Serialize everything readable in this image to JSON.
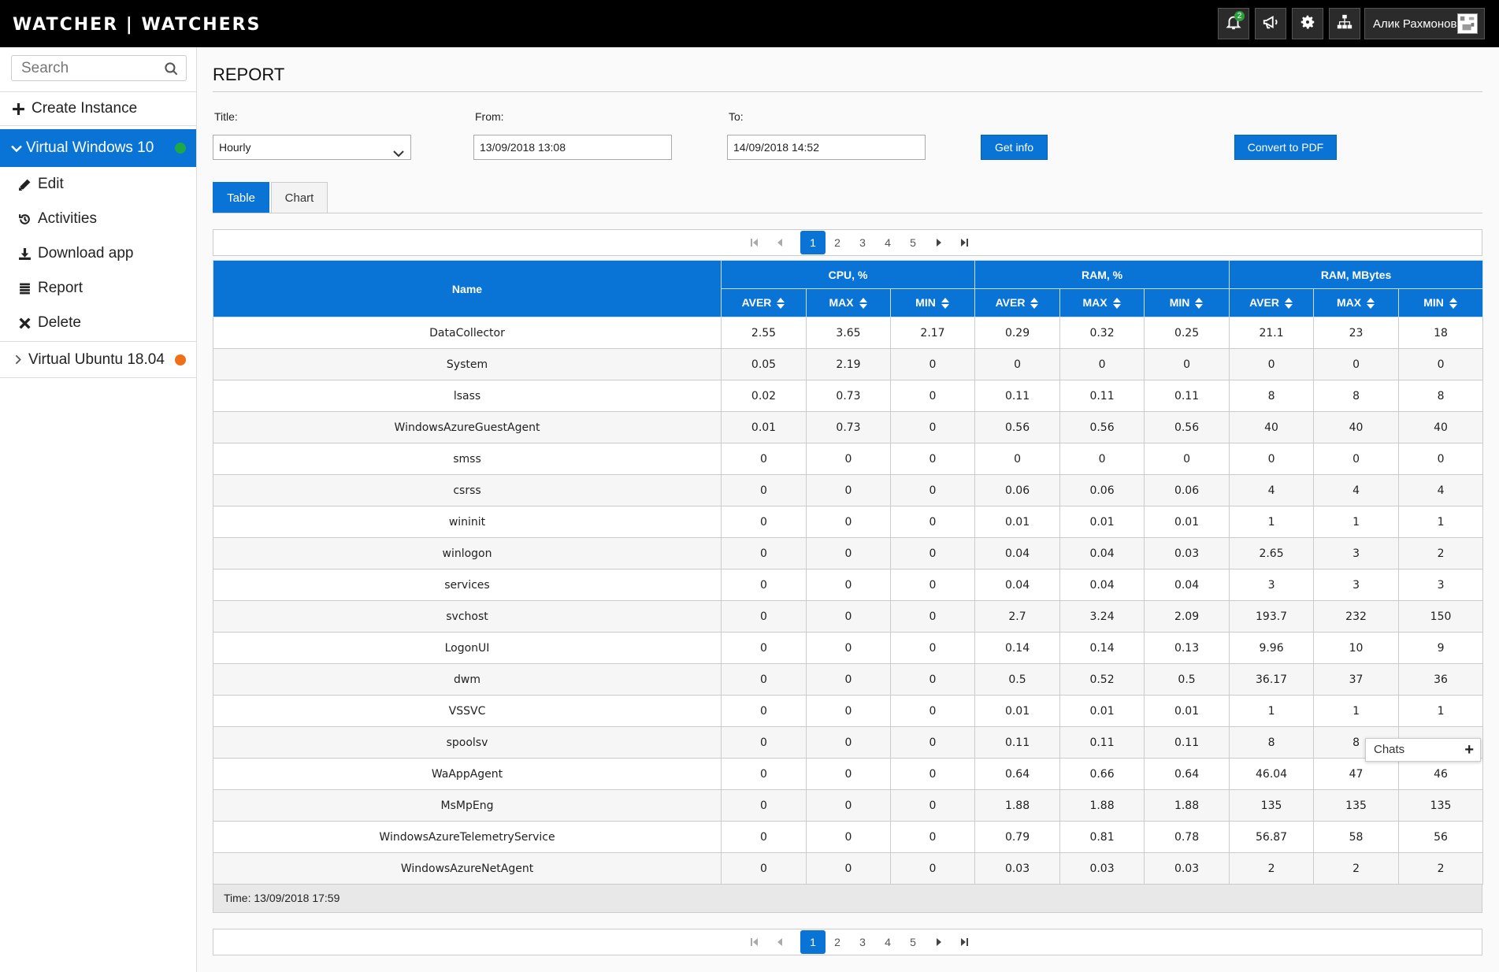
{
  "header": {
    "brand": "WATCHER | WATCHERS",
    "notifications_count": "2",
    "user_name": "Алик Рахмонов"
  },
  "sidebar": {
    "search_placeholder": "Search",
    "create_label": "Create Instance",
    "active_vm": {
      "label": "Virtual Windows 10",
      "status_color": "#1fa84a"
    },
    "sub_items": [
      "Edit",
      "Activities",
      "Download app",
      "Report",
      "Delete"
    ],
    "other_vm": {
      "label": "Virtual Ubuntu 18.04",
      "status_color": "#f07019"
    }
  },
  "report": {
    "title": "REPORT",
    "title_label": "Title:",
    "title_value": "Hourly",
    "from_label": "From:",
    "from_value": "13/09/2018 13:08",
    "to_label": "To:",
    "to_value": "14/09/2018 14:52",
    "get_info": "Get info",
    "convert_pdf": "Convert to PDF",
    "tabs": [
      "Table",
      "Chart"
    ],
    "pages": [
      "1",
      "2",
      "3",
      "4",
      "5"
    ],
    "current_page": "1",
    "columns": {
      "name": "Name",
      "groups": [
        "CPU, %",
        "RAM, %",
        "RAM, MBytes"
      ],
      "sub": [
        "AVER",
        "MAX",
        "MIN"
      ]
    },
    "rows": [
      [
        "DataCollector",
        "2.55",
        "3.65",
        "2.17",
        "0.29",
        "0.32",
        "0.25",
        "21.1",
        "23",
        "18"
      ],
      [
        "System",
        "0.05",
        "2.19",
        "0",
        "0",
        "0",
        "0",
        "0",
        "0",
        "0"
      ],
      [
        "lsass",
        "0.02",
        "0.73",
        "0",
        "0.11",
        "0.11",
        "0.11",
        "8",
        "8",
        "8"
      ],
      [
        "WindowsAzureGuestAgent",
        "0.01",
        "0.73",
        "0",
        "0.56",
        "0.56",
        "0.56",
        "40",
        "40",
        "40"
      ],
      [
        "smss",
        "0",
        "0",
        "0",
        "0",
        "0",
        "0",
        "0",
        "0",
        "0"
      ],
      [
        "csrss",
        "0",
        "0",
        "0",
        "0.06",
        "0.06",
        "0.06",
        "4",
        "4",
        "4"
      ],
      [
        "wininit",
        "0",
        "0",
        "0",
        "0.01",
        "0.01",
        "0.01",
        "1",
        "1",
        "1"
      ],
      [
        "winlogon",
        "0",
        "0",
        "0",
        "0.04",
        "0.04",
        "0.03",
        "2.65",
        "3",
        "2"
      ],
      [
        "services",
        "0",
        "0",
        "0",
        "0.04",
        "0.04",
        "0.04",
        "3",
        "3",
        "3"
      ],
      [
        "svchost",
        "0",
        "0",
        "0",
        "2.7",
        "3.24",
        "2.09",
        "193.7",
        "232",
        "150"
      ],
      [
        "LogonUI",
        "0",
        "0",
        "0",
        "0.14",
        "0.14",
        "0.13",
        "9.96",
        "10",
        "9"
      ],
      [
        "dwm",
        "0",
        "0",
        "0",
        "0.5",
        "0.52",
        "0.5",
        "36.17",
        "37",
        "36"
      ],
      [
        "VSSVC",
        "0",
        "0",
        "0",
        "0.01",
        "0.01",
        "0.01",
        "1",
        "1",
        "1"
      ],
      [
        "spoolsv",
        "0",
        "0",
        "0",
        "0.11",
        "0.11",
        "0.11",
        "8",
        "8",
        ""
      ],
      [
        "WaAppAgent",
        "0",
        "0",
        "0",
        "0.64",
        "0.66",
        "0.64",
        "46.04",
        "47",
        "46"
      ],
      [
        "MsMpEng",
        "0",
        "0",
        "0",
        "1.88",
        "1.88",
        "1.88",
        "135",
        "135",
        "135"
      ],
      [
        "WindowsAzureTelemetryService",
        "0",
        "0",
        "0",
        "0.79",
        "0.81",
        "0.78",
        "56.87",
        "58",
        "56"
      ],
      [
        "WindowsAzureNetAgent",
        "0",
        "0",
        "0",
        "0.03",
        "0.03",
        "0.03",
        "2",
        "2",
        "2"
      ]
    ],
    "footer_time": "Time: 13/09/2018 17:59"
  },
  "chats": {
    "label": "Chats"
  }
}
